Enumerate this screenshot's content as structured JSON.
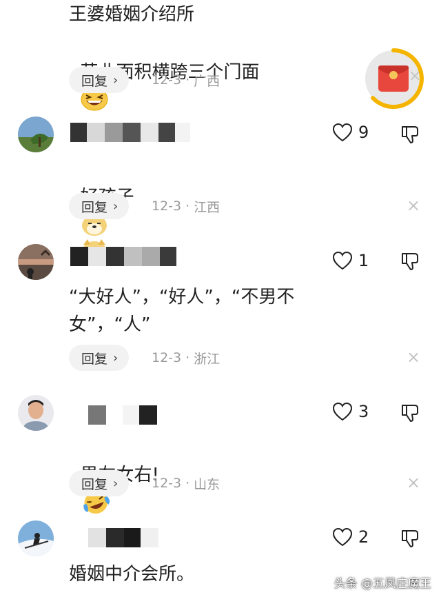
{
  "comments": [
    {
      "text_lines": [
        "王婆婚姻介绍所",
        "营业面积横跨三个门面"
      ],
      "reply_label": "回复",
      "date": "12-3",
      "location": "广西"
    },
    {
      "likes": "9",
      "text": "好孩子",
      "reply_label": "回复",
      "date": "12-3",
      "location": "江西"
    },
    {
      "likes": "1",
      "text_lines": [
        "“大好人”，“好人”，“不男不",
        "女”，“人”"
      ],
      "reply_label": "回复",
      "date": "12-3",
      "location": "浙江"
    },
    {
      "likes": "3",
      "text": "男左女右!",
      "reply_label": "回复",
      "date": "12-3",
      "location": "山东"
    },
    {
      "likes": "2",
      "text": "婚姻中介会所。"
    }
  ],
  "separator": "·",
  "chevron": "›",
  "close_glyph": "×",
  "watermark": "头条 @五凤庄魔王",
  "colors": {
    "red_packet": "#e8473d",
    "ring": "#f5b400",
    "emoji_yellow": "#f7c948"
  }
}
